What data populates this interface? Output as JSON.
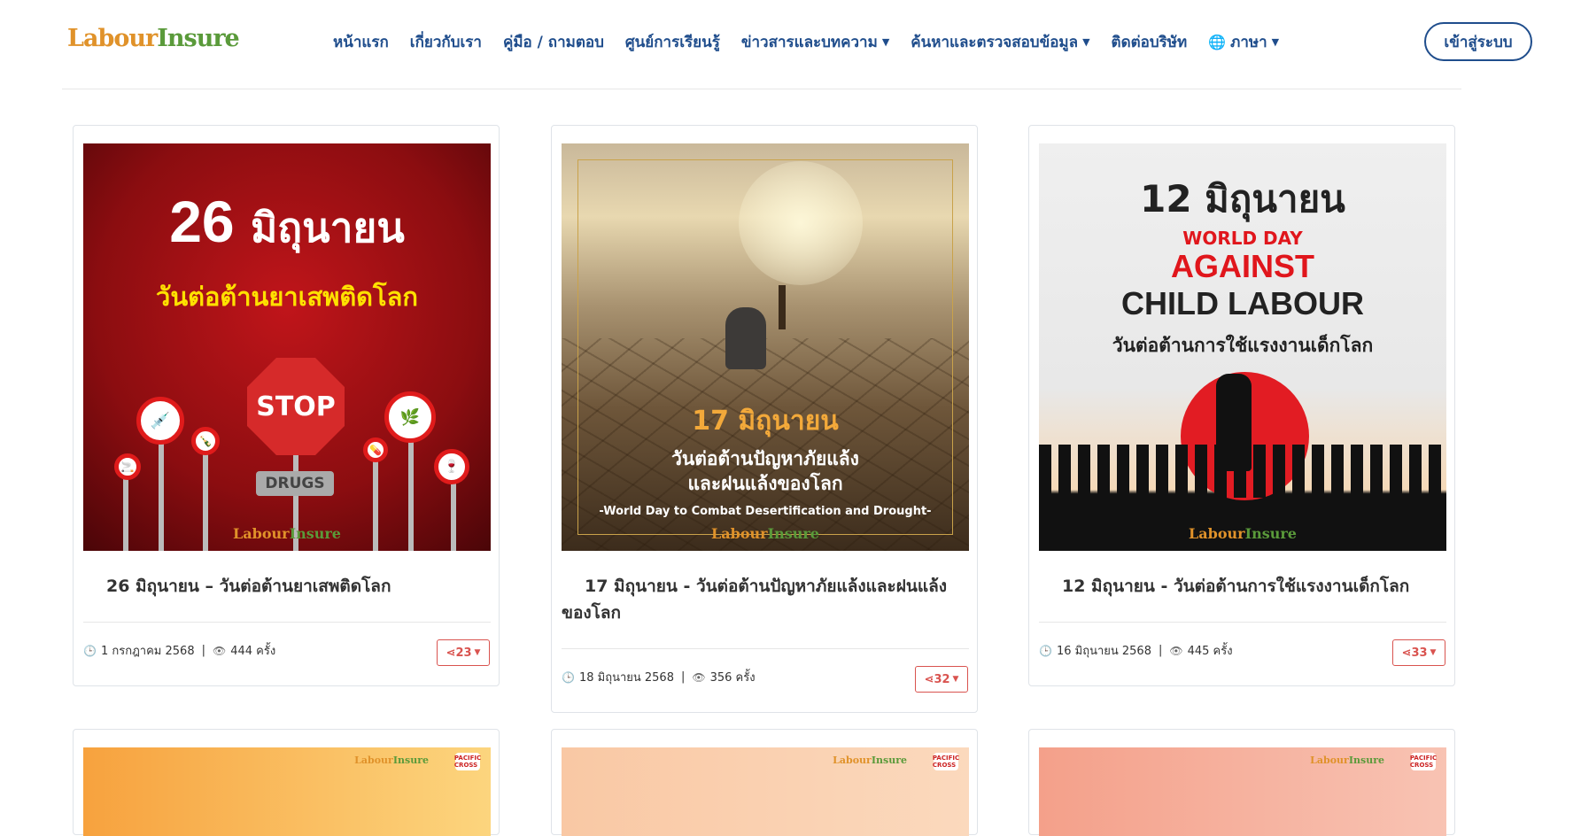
{
  "brand": {
    "logo_part1": "Labour",
    "logo_part2": "Insure"
  },
  "nav": {
    "items": [
      {
        "label": "หน้าแรก",
        "caret": false
      },
      {
        "label": "เกี่ยวกับเรา",
        "caret": false
      },
      {
        "label": "คู่มือ / ถามตอบ",
        "caret": false
      },
      {
        "label": "ศูนย์การเรียนรู้",
        "caret": false
      },
      {
        "label": "ข่าวสารและบทความ",
        "caret": true
      },
      {
        "label": "ค้นหาและตรวจสอบข้อมูล",
        "caret": true
      },
      {
        "label": "ติดต่อบริษัท",
        "caret": false
      }
    ],
    "language_label": "ภาษา",
    "login_label": "เข้าสู่ระบบ"
  },
  "cards": [
    {
      "title": "26 มิถุนายน – วันต่อต้านยาเสพติดโลก",
      "date": "1 กรกฎาคม 2568",
      "views": "444 ครั้ง",
      "shares": "23",
      "poster": {
        "day": "26",
        "month": "มิถุนายน",
        "subtitle": "วันต่อต้านยาเสพติดโลก",
        "stop": "STOP",
        "drugs": "DRUGS"
      }
    },
    {
      "title": "17 มิถุนายน - วันต่อต้านปัญหาภัยแล้งและฝนแล้งของโลก",
      "date": "18 มิถุนายน 2568",
      "views": "356 ครั้ง",
      "shares": "32",
      "poster": {
        "date": "17 มิถุนายน",
        "line1": "วันต่อต้านปัญหาภัยแล้ง",
        "line2": "และฝนแล้งของโลก",
        "line3": "-World Day to Combat Desertification and Drought-"
      }
    },
    {
      "title": "12 มิถุนายน - วันต่อต้านการใช้แรงงานเด็กโลก",
      "date": "16 มิถุนายน 2568",
      "views": "445 ครั้ง",
      "shares": "33",
      "poster": {
        "date": "12 มิถุนายน",
        "line1": "WORLD DAY",
        "line2": "AGAINST",
        "line3": "CHILD LABOUR",
        "line4": "วันต่อต้านการใช้แรงงานเด็กโลก"
      }
    }
  ],
  "bottom_cards": [
    {
      "badge": "PACIFIC CROSS"
    },
    {
      "badge": "PACIFIC CROSS"
    },
    {
      "badge": "PACIFIC CROSS"
    }
  ],
  "colors": {
    "nav": "#1f4d8c",
    "accent_orange": "#e0922a",
    "accent_green": "#5a9a3a",
    "share": "#d9534f"
  }
}
